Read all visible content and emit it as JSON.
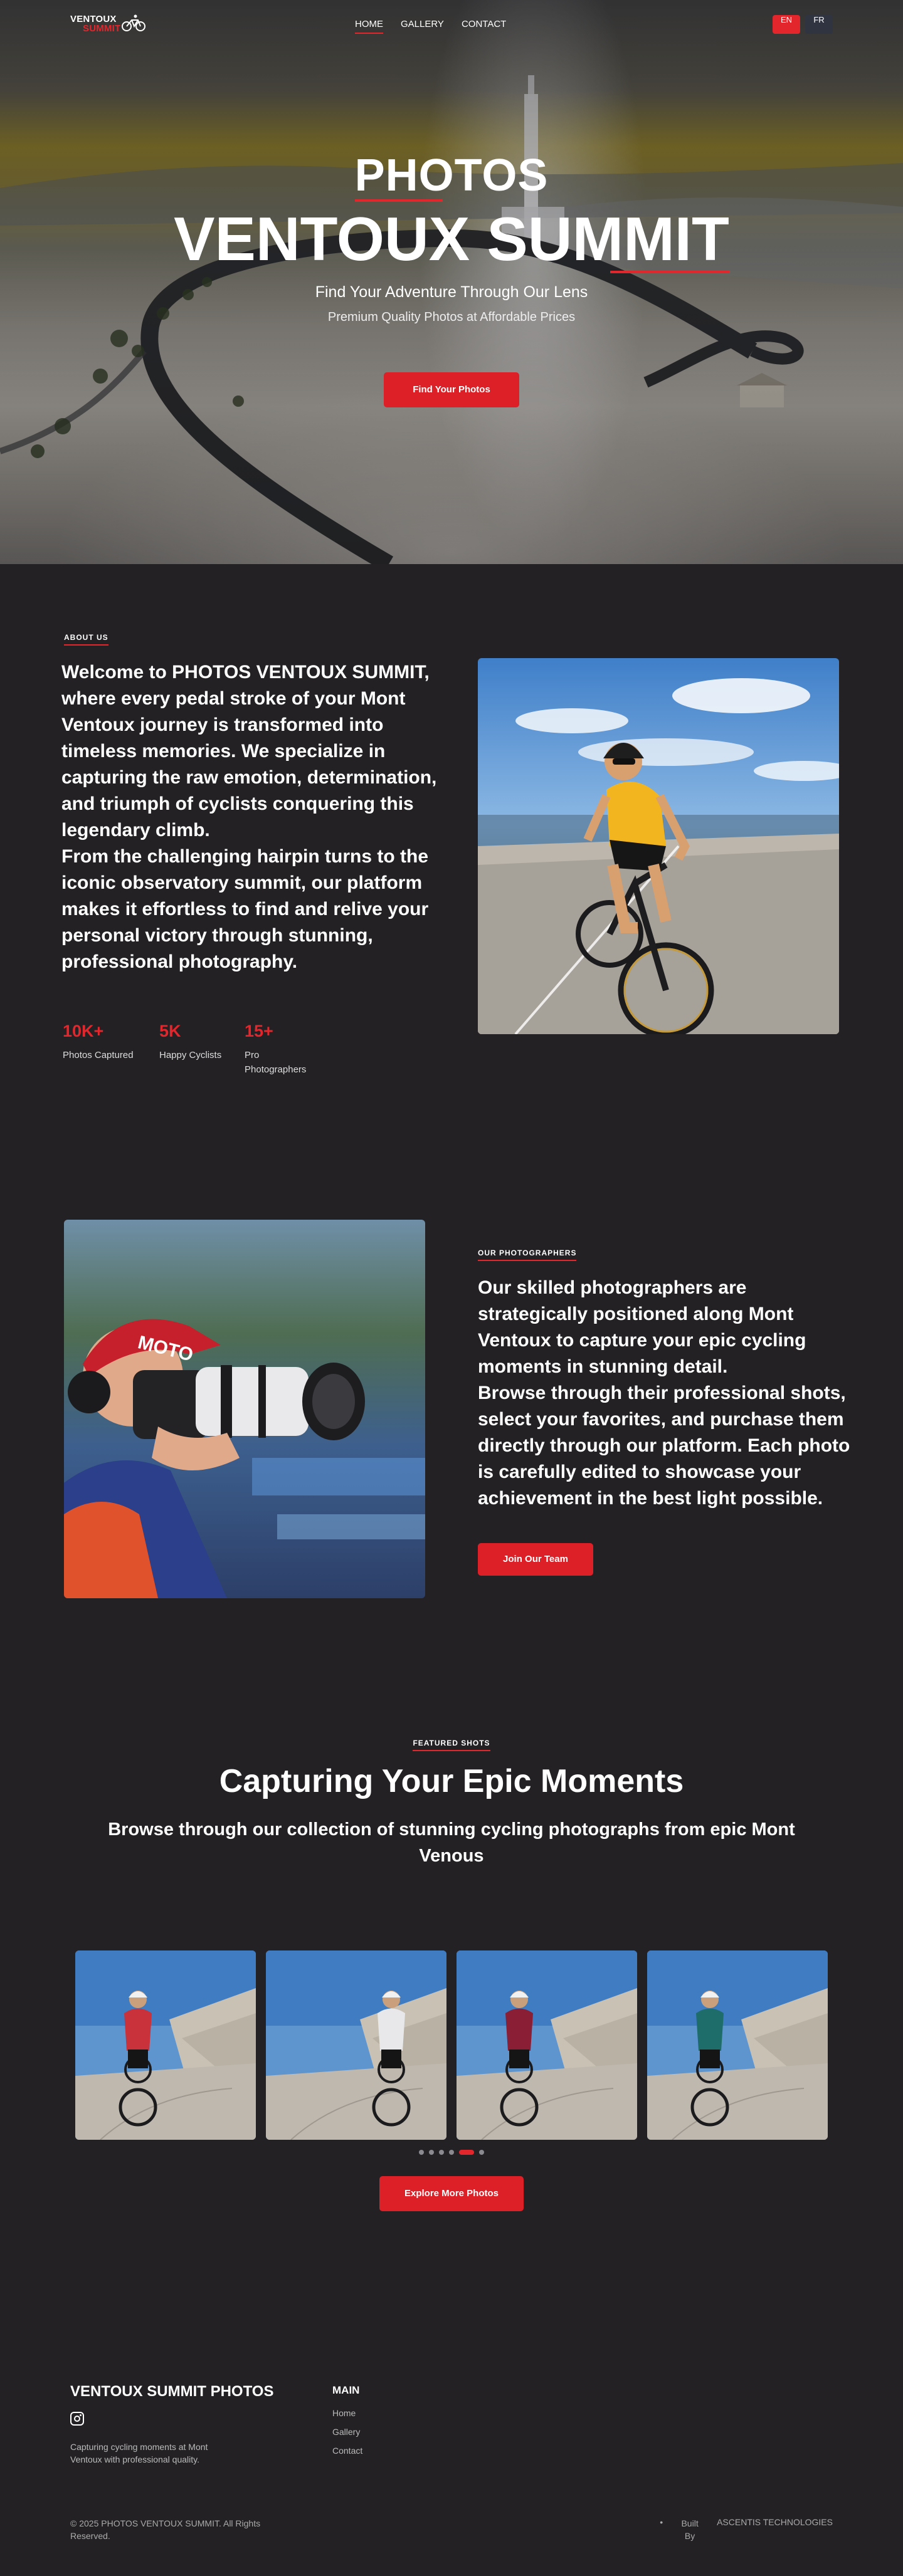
{
  "nav": {
    "logo_top": "VENTOUX",
    "logo_bottom": "SUMMIT",
    "menu": [
      "HOME",
      "GALLERY",
      "CONTACT"
    ],
    "lang": [
      "EN",
      "FR"
    ]
  },
  "hero": {
    "title1": "PHOTOS",
    "title2": "VENTOUX SUMMIT",
    "subtitle": "Find Your Adventure Through Our Lens",
    "tagline": "Premium Quality Photos at Affordable Prices",
    "button": "Find Your Photos"
  },
  "about": {
    "label": "ABOUT US",
    "paragraph1": "Welcome to PHOTOS VENTOUX SUMMIT, where every pedal stroke of your Mont Ventoux journey is transformed into timeless memories. We specialize in capturing the raw emotion, determination, and triumph of cyclists conquering this legendary climb.",
    "paragraph2": "From the challenging hairpin turns to the iconic observatory summit, our platform makes it effortless to find and relive your personal victory through stunning, professional photography.",
    "stats": [
      {
        "value": "10K+",
        "label": "Photos Captured"
      },
      {
        "value": "5K",
        "label": "Happy Cyclists"
      },
      {
        "value": "15+",
        "label": "Pro Photographers"
      }
    ]
  },
  "photographers": {
    "label": "OUR PHOTOGRAPHERS",
    "paragraph1": "Our skilled photographers are strategically positioned along Mont Ventoux to capture your epic cycling moments in stunning detail.",
    "paragraph2": "Browse through their professional shots, select your favorites, and purchase them directly through our platform. Each photo is carefully edited to showcase your achievement in the best light possible.",
    "button": "Join Our Team",
    "cap_text": "MOTO"
  },
  "featured": {
    "label": "FEATURED SHOTS",
    "title": "Capturing Your Epic Moments",
    "subtitle": "Browse through our collection of stunning cycling photographs from epic Mont Venous",
    "button": "Explore More Photos",
    "slides": [
      {
        "jersey": "#c9323a"
      },
      {
        "jersey": "#e8e8ea"
      },
      {
        "jersey": "#8a1e34"
      },
      {
        "jersey": "#1f6d6a"
      }
    ],
    "dots": 6,
    "active_dot": 4
  },
  "footer": {
    "brand": "VENTOUX SUMMIT PHOTOS",
    "description": "Capturing cycling moments at Mont Ventoux with professional quality.",
    "main_heading": "MAIN",
    "links": [
      "Home",
      "Gallery",
      "Contact"
    ],
    "copyright": "© 2025 PHOTOS VENTOUX SUMMIT. All Rights Reserved.",
    "built_label": "Built By",
    "built_by": "ASCENTIS TECHNOLOGIES"
  },
  "colors": {
    "accent": "#e3262c",
    "background": "#232124"
  }
}
